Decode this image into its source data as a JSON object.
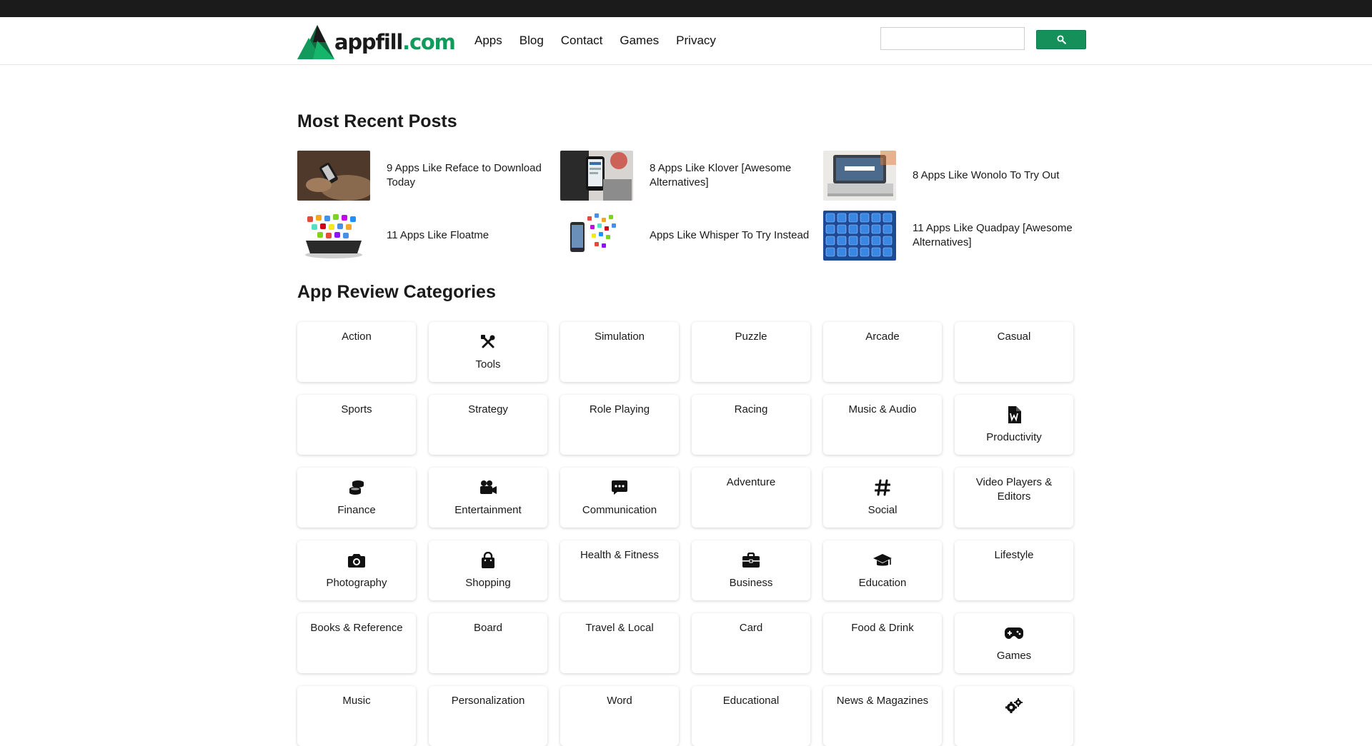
{
  "brand": {
    "name_main": "appfill",
    "name_suffix": ".com",
    "colors": {
      "green": "#129a5c",
      "dark": "#1b1b1b"
    }
  },
  "nav": {
    "items": [
      "Apps",
      "Blog",
      "Contact",
      "Games",
      "Privacy"
    ]
  },
  "search": {
    "value": "",
    "button_icon": "search-icon"
  },
  "recent": {
    "title": "Most Recent Posts",
    "posts": [
      {
        "title": "9 Apps Like Reface to Download Today",
        "thumb": "phone-in-hands"
      },
      {
        "title": "8 Apps Like Klover [Awesome Alternatives]",
        "thumb": "phone-app-screen"
      },
      {
        "title": "8 Apps Like Wonolo To Try Out",
        "thumb": "laptop-search"
      },
      {
        "title": "11 Apps Like Floatme",
        "thumb": "tablet-app-icons"
      },
      {
        "title": "Apps Like Whisper To Try Instead",
        "thumb": "phone-floating-icons"
      },
      {
        "title": "11 Apps Like Quadpay [Awesome Alternatives]",
        "thumb": "blue-app-tiles"
      }
    ]
  },
  "categories": {
    "title": "App Review Categories",
    "items": [
      {
        "label": "Action",
        "icon": ""
      },
      {
        "label": "Tools",
        "icon": "tools-icon"
      },
      {
        "label": "Simulation",
        "icon": ""
      },
      {
        "label": "Puzzle",
        "icon": ""
      },
      {
        "label": "Arcade",
        "icon": ""
      },
      {
        "label": "Casual",
        "icon": ""
      },
      {
        "label": "Sports",
        "icon": ""
      },
      {
        "label": "Strategy",
        "icon": ""
      },
      {
        "label": "Role Playing",
        "icon": ""
      },
      {
        "label": "Racing",
        "icon": ""
      },
      {
        "label": "Music & Audio",
        "icon": ""
      },
      {
        "label": "Productivity",
        "icon": "word-file-icon"
      },
      {
        "label": "Finance",
        "icon": "coins-icon"
      },
      {
        "label": "Entertainment",
        "icon": "video-camera-icon"
      },
      {
        "label": "Communication",
        "icon": "chat-icon"
      },
      {
        "label": "Adventure",
        "icon": ""
      },
      {
        "label": "Social",
        "icon": "hashtag-icon"
      },
      {
        "label": "Video Players & Editors",
        "icon": ""
      },
      {
        "label": "Photography",
        "icon": "camera-icon"
      },
      {
        "label": "Shopping",
        "icon": "shopping-bag-icon"
      },
      {
        "label": "Health & Fitness",
        "icon": ""
      },
      {
        "label": "Business",
        "icon": "briefcase-icon"
      },
      {
        "label": "Education",
        "icon": "graduation-cap-icon"
      },
      {
        "label": "Lifestyle",
        "icon": ""
      },
      {
        "label": "Books & Reference",
        "icon": ""
      },
      {
        "label": "Board",
        "icon": ""
      },
      {
        "label": "Travel & Local",
        "icon": ""
      },
      {
        "label": "Card",
        "icon": ""
      },
      {
        "label": "Food & Drink",
        "icon": ""
      },
      {
        "label": "Games",
        "icon": "gamepad-icon"
      },
      {
        "label": "Music",
        "icon": ""
      },
      {
        "label": "Personalization",
        "icon": ""
      },
      {
        "label": "Word",
        "icon": ""
      },
      {
        "label": "Educational",
        "icon": ""
      },
      {
        "label": "News & Magazines",
        "icon": ""
      },
      {
        "label": "",
        "icon": "gears-icon"
      }
    ]
  }
}
